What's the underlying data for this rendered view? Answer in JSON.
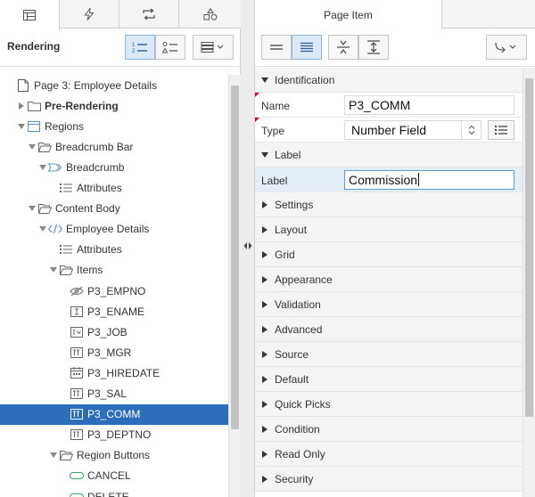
{
  "left_panel": {
    "tabs": [
      {
        "name": "rendering-tab",
        "icon": "grid-icon",
        "active": true
      },
      {
        "name": "dynamic-actions-tab",
        "icon": "lightning-icon",
        "active": false
      },
      {
        "name": "processing-tab",
        "icon": "loop-arrows-icon",
        "active": false
      },
      {
        "name": "shared-components-tab",
        "icon": "shapes-icon",
        "active": false
      }
    ],
    "toolbar": {
      "title": "Rendering"
    },
    "tree": [
      {
        "label": "Page 3: Employee Details",
        "level": 0,
        "twisty": "",
        "icon": "page-icon",
        "bold": false
      },
      {
        "label": "Pre-Rendering",
        "level": 1,
        "twisty": "right",
        "icon": "folder-icon",
        "bold": true
      },
      {
        "label": "Regions",
        "level": 1,
        "twisty": "down",
        "icon": "region-icon",
        "bold": false
      },
      {
        "label": "Breadcrumb Bar",
        "level": 2,
        "twisty": "down",
        "icon": "folder-open-icon",
        "bold": false
      },
      {
        "label": "Breadcrumb",
        "level": 3,
        "twisty": "down",
        "icon": "breadcrumb-icon",
        "bold": false
      },
      {
        "label": "Attributes",
        "level": 4,
        "twisty": "",
        "icon": "attributes-icon",
        "bold": false
      },
      {
        "label": "Content Body",
        "level": 2,
        "twisty": "down",
        "icon": "folder-open-icon",
        "bold": false
      },
      {
        "label": "Employee Details",
        "level": 3,
        "twisty": "down",
        "icon": "code-icon",
        "bold": false
      },
      {
        "label": "Attributes",
        "level": 4,
        "twisty": "",
        "icon": "attributes-icon",
        "bold": false
      },
      {
        "label": "Items",
        "level": 4,
        "twisty": "down",
        "icon": "folder-open-icon",
        "bold": false
      },
      {
        "label": "P3_EMPNO",
        "level": 5,
        "twisty": "",
        "icon": "hidden-item-icon",
        "bold": false
      },
      {
        "label": "P3_ENAME",
        "level": 5,
        "twisty": "",
        "icon": "text-field-icon",
        "bold": false
      },
      {
        "label": "P3_JOB",
        "level": 5,
        "twisty": "",
        "icon": "select-list-icon",
        "bold": false
      },
      {
        "label": "P3_MGR",
        "level": 5,
        "twisty": "",
        "icon": "number-field-icon",
        "bold": false
      },
      {
        "label": "P3_HIREDATE",
        "level": 5,
        "twisty": "",
        "icon": "date-picker-icon",
        "bold": false
      },
      {
        "label": "P3_SAL",
        "level": 5,
        "twisty": "",
        "icon": "number-field-icon",
        "bold": false
      },
      {
        "label": "P3_COMM",
        "level": 5,
        "twisty": "",
        "icon": "number-field-icon",
        "bold": false,
        "selected": true
      },
      {
        "label": "P3_DEPTNO",
        "level": 5,
        "twisty": "",
        "icon": "number-field-icon",
        "bold": false
      },
      {
        "label": "Region Buttons",
        "level": 4,
        "twisty": "down",
        "icon": "folder-open-icon",
        "bold": false
      },
      {
        "label": "CANCEL",
        "level": 5,
        "twisty": "",
        "icon": "button-icon",
        "bold": false
      },
      {
        "label": "DELETE",
        "level": 5,
        "twisty": "",
        "icon": "button-icon",
        "bold": false
      }
    ]
  },
  "right_panel": {
    "tab_title": "Page Item",
    "identification": {
      "group": "Identification",
      "name_label": "Name",
      "name_value": "P3_COMM",
      "type_label": "Type",
      "type_value": "Number Field"
    },
    "label_group": {
      "group": "Label",
      "label_label": "Label",
      "label_value": "Commission"
    },
    "collapsed_groups": [
      "Settings",
      "Layout",
      "Grid",
      "Appearance",
      "Validation",
      "Advanced",
      "Source",
      "Default",
      "Quick Picks",
      "Condition",
      "Read Only",
      "Security"
    ]
  },
  "colors": {
    "selected_row": "#2c6eba",
    "toggle_on": "#dbe9f8",
    "highlight_row": "#e3eef9",
    "required_marker": "#d0021b"
  }
}
